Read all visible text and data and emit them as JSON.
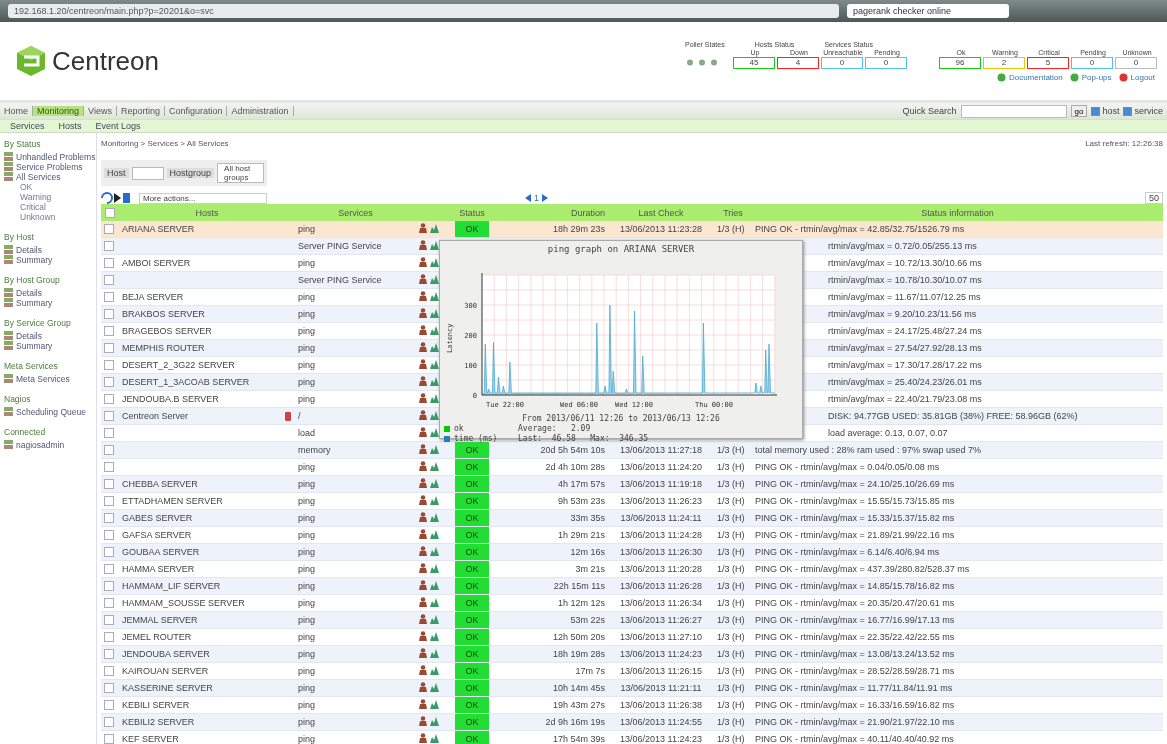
{
  "browser": {
    "address": "192.168.1.20/centreon/main.php?p=20201&o=svc",
    "search": "pagerank checker online"
  },
  "header": {
    "logo": "Centreon",
    "poller_label": "Poller States",
    "host_label": "Hosts Status",
    "service_label": "Services Status",
    "host_states": [
      {
        "label": "Up",
        "count": "45",
        "color": "#19c919"
      },
      {
        "label": "Down",
        "count": "4",
        "color": "#ff2020"
      },
      {
        "label": "Unreachable",
        "count": "0",
        "color": "#4fc6e0"
      },
      {
        "label": "Pending",
        "count": "0",
        "color": "#4fc6e0"
      }
    ],
    "service_states": [
      {
        "label": "Ok",
        "count": "96",
        "color": "#19c919"
      },
      {
        "label": "Warning",
        "count": "2",
        "color": "#f0c400"
      },
      {
        "label": "Critical",
        "count": "5",
        "color": "#ff2020"
      },
      {
        "label": "Pending",
        "count": "0",
        "color": "#4fc6e0"
      },
      {
        "label": "Unknown",
        "count": "0",
        "color": "#bbbbbb"
      }
    ],
    "links": [
      "Documentation",
      "Pop-ups",
      "Logout"
    ]
  },
  "menu": {
    "tabs": [
      {
        "label": "Home",
        "selected": false
      },
      {
        "label": "Monitoring",
        "selected": true
      },
      {
        "label": "Views",
        "selected": false
      },
      {
        "label": "Reporting",
        "selected": false
      },
      {
        "label": "Configuration",
        "selected": false
      },
      {
        "label": "Administration",
        "selected": false
      }
    ],
    "search_label": "Quick Search",
    "go": "go",
    "options": [
      {
        "label": "host",
        "checked": true
      },
      {
        "label": "service",
        "checked": true
      }
    ]
  },
  "submenu": [
    "Services",
    "Hosts",
    "Event Logs"
  ],
  "sidebar": [
    {
      "title": "By Status",
      "items": [
        {
          "label": "Unhandled Problems"
        },
        {
          "label": "Service Problems"
        },
        {
          "label": "All Services",
          "children": [
            {
              "label": "OK"
            },
            {
              "label": "Warning"
            },
            {
              "label": "Critical"
            },
            {
              "label": "Unknown"
            }
          ]
        }
      ]
    },
    {
      "title": "By Host",
      "items": [
        {
          "label": "Details"
        },
        {
          "label": "Summary"
        }
      ]
    },
    {
      "title": "By Host Group",
      "items": [
        {
          "label": "Details"
        },
        {
          "label": "Summary"
        }
      ]
    },
    {
      "title": "By Service Group",
      "items": [
        {
          "label": "Details"
        },
        {
          "label": "Summary"
        }
      ]
    },
    {
      "title": "Meta Services",
      "items": [
        {
          "label": "Meta Services"
        }
      ]
    },
    {
      "title": "Nagios",
      "items": [
        {
          "label": "Scheduling Queue"
        }
      ]
    },
    {
      "title": "Connected",
      "items": [
        {
          "label": "nagiosadmin"
        }
      ]
    }
  ],
  "breadcrumb": "Monitoring > Services > All Services",
  "last_refresh": "Last refresh: 12:26:38",
  "filters": {
    "host_label": "Host",
    "hostgroup_label": "Hostgroup",
    "hostgroup_value": "All host groups"
  },
  "toolbar": {
    "actions": "More actions...",
    "page": "1",
    "limit": "50"
  },
  "table": {
    "select_all_checked": false,
    "columns": [
      "Hosts",
      "Services",
      "Status",
      "Duration",
      "Last Check",
      "Tries",
      "Status information"
    ],
    "rows": [
      {
        "host": "ARIANA SERVER",
        "service": "ping",
        "status": "OK",
        "duration": "18h 29m 23s",
        "last_check": "13/06/2013 11:23:28",
        "tries": "1/3 (H)",
        "info": "PING OK - rtmin/avg/max = 42.85/32.75/1526.79 ms",
        "selected": true,
        "checked": false,
        "flagged": false
      },
      {
        "host": "",
        "service": "Server PING Service",
        "info": "rtmin/avg/max = 0.72/0.05/255.13 ms",
        "selected": false,
        "checked": false,
        "flagged": false
      },
      {
        "host": "AMBOI SERVER",
        "service": "ping",
        "info": "rtmin/avg/max = 10.72/13.30/10.66 ms",
        "selected": false,
        "checked": false,
        "flagged": false
      },
      {
        "host": "",
        "service": "Server PING Service",
        "info": "rtmin/avg/max = 10.78/10.30/10.07 ms",
        "selected": false,
        "checked": false,
        "flagged": false
      },
      {
        "host": "BEJA SERVER",
        "service": "ping",
        "info": "rtmin/avg/max = 11.67/11.07/12.25 ms",
        "selected": false,
        "checked": false,
        "flagged": false
      },
      {
        "host": "BRAKBOS SERVER",
        "service": "ping",
        "info": "rtmin/avg/max = 9.20/10.23/11.56 ms",
        "selected": false,
        "checked": false,
        "flagged": false
      },
      {
        "host": "BRAGEBOS SERVER",
        "service": "ping",
        "info": "rtmin/avg/max = 24.17/25.48/27.24 ms",
        "selected": false,
        "checked": false,
        "flagged": false
      },
      {
        "host": "MEMPHIS ROUTER",
        "service": "ping",
        "info": "rtmin/avg/max = 27.54/27.92/28.13 ms",
        "selected": false,
        "checked": false,
        "flagged": false
      },
      {
        "host": "DESERT_2_3G22 SERVER",
        "service": "ping",
        "info": "rtmin/avg/max = 17.30/17.28/17.22 ms",
        "selected": false,
        "checked": false,
        "flagged": false
      },
      {
        "host": "DESERT_1_3ACOAB SERVER",
        "service": "ping",
        "info": "rtmin/avg/max = 25.40/24.23/26.01 ms",
        "selected": false,
        "checked": false,
        "flagged": false
      },
      {
        "host": "JENDOUBA.B SERVER",
        "service": "ping",
        "info": "rtmin/avg/max = 22.40/21.79/23.08 ms",
        "selected": false,
        "checked": false,
        "flagged": false
      },
      {
        "host": "Centreon Server",
        "service": "/",
        "info": "DISK: 94.77GB USED: 35.81GB (38%) FREE: 58.96GB (62%)",
        "selected": false,
        "checked": false,
        "flagged": true
      },
      {
        "host": "",
        "service": "load",
        "info": "load average: 0.13, 0.07, 0.07",
        "selected": false,
        "checked": false,
        "flagged": false
      },
      {
        "host": "",
        "service": "memory",
        "status": "OK",
        "duration": "20d 5h 54m 10s",
        "last_check": "13/06/2013 11:27:18",
        "tries": "1/3 (H)",
        "info": "total memory used : 28% ram used : 97% swap used 7%",
        "selected": false,
        "checked": false,
        "flagged": false
      },
      {
        "host": "",
        "service": "ping",
        "status": "OK",
        "duration": "2d 4h 10m 28s",
        "last_check": "13/06/2013 11:24:20",
        "tries": "1/3 (H)",
        "info": "PING OK - rtmin/avg/max = 0.04/0.05/0.08 ms",
        "selected": false,
        "checked": false,
        "flagged": false
      },
      {
        "host": "CHEBBA SERVER",
        "service": "ping",
        "status": "OK",
        "duration": "4h 17m 57s",
        "last_check": "13/06/2013 11:19:18",
        "tries": "1/3 (H)",
        "info": "PING OK - rtmin/avg/max = 24.10/25.10/26.69 ms",
        "selected": false,
        "checked": false,
        "flagged": false
      },
      {
        "host": "ETTADHAMEN SERVER",
        "service": "ping",
        "status": "OK",
        "duration": "9h 53m 23s",
        "last_check": "13/06/2013 11:26:23",
        "tries": "1/3 (H)",
        "info": "PING OK - rtmin/avg/max = 15.55/15.73/15.85 ms",
        "selected": false,
        "checked": false,
        "flagged": false
      },
      {
        "host": "GABES SERVER",
        "service": "ping",
        "status": "OK",
        "duration": "33m 35s",
        "last_check": "13/06/2013 11:24:11",
        "tries": "1/3 (H)",
        "info": "PING OK - rtmin/avg/max = 15.33/15.37/15.82 ms",
        "selected": false,
        "checked": false,
        "flagged": false
      },
      {
        "host": "GAFSA SERVER",
        "service": "ping",
        "status": "OK",
        "duration": "1h 29m 21s",
        "last_check": "13/06/2013 11:24:28",
        "tries": "1/3 (H)",
        "info": "PING OK - rtmin/avg/max = 21.89/21.99/22.16 ms",
        "selected": false,
        "checked": false,
        "flagged": false
      },
      {
        "host": "GOUBAA SERVER",
        "service": "ping",
        "status": "OK",
        "duration": "12m 16s",
        "last_check": "13/06/2013 11:26:30",
        "tries": "1/3 (H)",
        "info": "PING OK - rtmin/avg/max = 6.14/6.40/6.94 ms",
        "selected": false,
        "checked": false,
        "flagged": false
      },
      {
        "host": "HAMMA SERVER",
        "service": "ping",
        "status": "OK",
        "duration": "3m 21s",
        "last_check": "13/06/2013 11:20:28",
        "tries": "1/3 (H)",
        "info": "PING OK - rtmin/avg/max = 437.39/280.82/528.37 ms",
        "selected": false,
        "checked": false,
        "flagged": false
      },
      {
        "host": "HAMMAM_LIF SERVER",
        "service": "ping",
        "status": "OK",
        "duration": "22h 15m 11s",
        "last_check": "13/06/2013 11:26:28",
        "tries": "1/3 (H)",
        "info": "PING OK - rtmin/avg/max = 14.85/15.78/16.82 ms",
        "selected": false,
        "checked": false,
        "flagged": false
      },
      {
        "host": "HAMMAM_SOUSSE SERVER",
        "service": "ping",
        "status": "OK",
        "duration": "1h 12m 12s",
        "last_check": "13/06/2013 11:26:34",
        "tries": "1/3 (H)",
        "info": "PING OK - rtmin/avg/max = 20.35/20.47/20.61 ms",
        "selected": false,
        "checked": false,
        "flagged": false
      },
      {
        "host": "JEMMAL SERVER",
        "service": "ping",
        "status": "OK",
        "duration": "53m 22s",
        "last_check": "13/06/2013 11:26:27",
        "tries": "1/3 (H)",
        "info": "PING OK - rtmin/avg/max = 16.77/16.99/17.13 ms",
        "selected": false,
        "checked": false,
        "flagged": false
      },
      {
        "host": "JEMEL ROUTER",
        "service": "ping",
        "status": "OK",
        "duration": "12h 50m 20s",
        "last_check": "13/06/2013 11:27:10",
        "tries": "1/3 (H)",
        "info": "PING OK - rtmin/avg/max = 22.35/22.42/22.55 ms",
        "selected": false,
        "checked": false,
        "flagged": false
      },
      {
        "host": "JENDOUBA SERVER",
        "service": "ping",
        "status": "OK",
        "duration": "18h 19m 28s",
        "last_check": "13/06/2013 11:24:23",
        "tries": "1/3 (H)",
        "info": "PING OK - rtmin/avg/max = 13.08/13.24/13.52 ms",
        "selected": false,
        "checked": false,
        "flagged": false
      },
      {
        "host": "KAIROUAN SERVER",
        "service": "ping",
        "status": "OK",
        "duration": "17m 7s",
        "last_check": "13/06/2013 11:26:15",
        "tries": "1/3 (H)",
        "info": "PING OK - rtmin/avg/max = 28.52/28.59/28.71 ms",
        "selected": false,
        "checked": false,
        "flagged": false
      },
      {
        "host": "KASSERINE SERVER",
        "service": "ping",
        "status": "OK",
        "duration": "10h 14m 45s",
        "last_check": "13/06/2013 11:21:11",
        "tries": "1/3 (H)",
        "info": "PING OK - rtmin/avg/max = 11.77/11.84/11.91 ms",
        "selected": false,
        "checked": false,
        "flagged": false
      },
      {
        "host": "KEBILI SERVER",
        "service": "ping",
        "status": "OK",
        "duration": "19h 43m 27s",
        "last_check": "13/06/2013 11:26:38",
        "tries": "1/3 (H)",
        "info": "PING OK - rtmin/avg/max = 16.33/16.59/16.82 ms",
        "selected": false,
        "checked": false,
        "flagged": false
      },
      {
        "host": "KEBILI2 SERVER",
        "service": "ping",
        "status": "OK",
        "duration": "2d 9h 16m 19s",
        "last_check": "13/06/2013 11:24:55",
        "tries": "1/3 (H)",
        "info": "PING OK - rtmin/avg/max = 21.90/21.97/22.10 ms",
        "selected": false,
        "checked": false,
        "flagged": false
      },
      {
        "host": "KEF SERVER",
        "service": "ping",
        "status": "OK",
        "duration": "17h 54m 39s",
        "last_check": "13/06/2013 11:24:23",
        "tries": "1/3 (H)",
        "info": "PING OK - rtmin/avg/max = 40.11/40.40/40.92 ms",
        "selected": false,
        "checked": false,
        "flagged": false
      }
    ]
  },
  "graph": {
    "title": "ping graph on ARIANA SERVER",
    "ylabel": "Latency",
    "yticks": [
      "300",
      "200",
      "100",
      "0"
    ],
    "xticks": [
      "Tue 22:00",
      "Wed 06:00",
      "Wed 12:00",
      "Thu 00:00"
    ],
    "range": "From 2013/06/11 12:26 to 2013/06/13 12:26",
    "legend": [
      {
        "name": "ok",
        "color": "#00cc00",
        "stats": "Average:   2.09"
      },
      {
        "name": "time (ms)",
        "color": "#1f7fc0",
        "stats": "Last:  46.58   Max:  346.35"
      }
    ]
  }
}
